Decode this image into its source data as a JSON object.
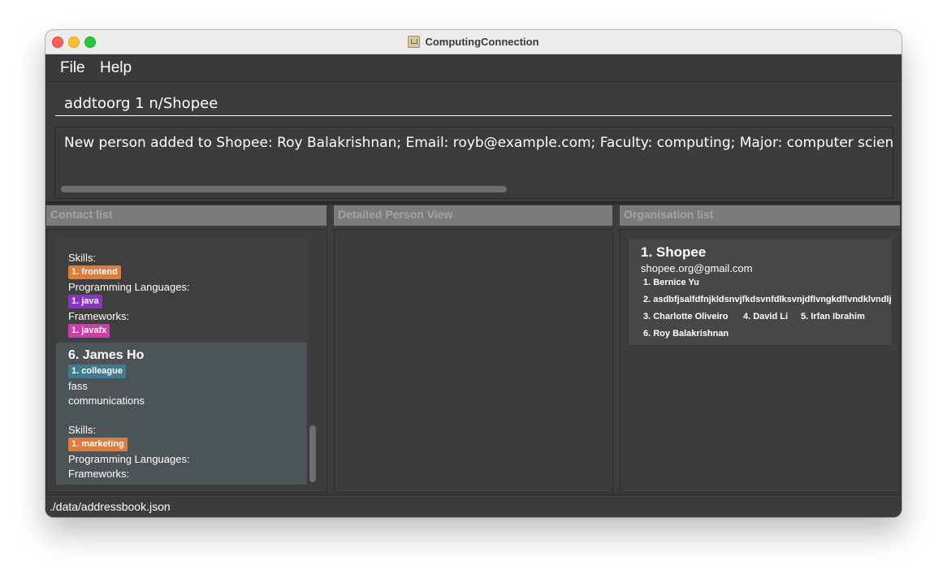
{
  "window": {
    "title": "ComputingConnection"
  },
  "menu": {
    "file": "File",
    "help": "Help"
  },
  "command": {
    "value": "addtoorg 1 n/Shopee"
  },
  "result": {
    "text": "New person added to Shopee: Roy Balakrishnan; Email: royb@example.com; Faculty: computing; Major: computer science; Compatability"
  },
  "panels": {
    "contact_list": "Contact list",
    "detail_view": "Detailed Person View",
    "org_list": "Organisation list"
  },
  "contacts": {
    "partial": {
      "skills_label": "Skills:",
      "skills": [
        "1. frontend"
      ],
      "languages_label": "Programming Languages:",
      "languages": [
        "1. java"
      ],
      "frameworks_label": "Frameworks:",
      "frameworks": [
        "1. javafx"
      ]
    },
    "james": {
      "name": "6.  James Ho",
      "tags": [
        "1. colleague"
      ],
      "faculty": "fass",
      "major": "communications",
      "skills_label": "Skills:",
      "skills": [
        "1. marketing"
      ],
      "languages_label": "Programming Languages:",
      "frameworks_label": "Frameworks:"
    }
  },
  "organisations": [
    {
      "name": "1.  Shopee",
      "email": "shopee.org@gmail.com",
      "members": [
        "1. Bernice Yu",
        "2. asdbfjsalfdfnjkldsnvjfkdsvnfdlksvnjdflvngkdflvndklvndlj",
        "3. Charlotte Oliveiro",
        "4. David Li",
        "5. Irfan Ibrahim",
        "6. Roy Balakrishnan"
      ]
    }
  ],
  "status": {
    "path": "./data/addressbook.json"
  },
  "colors": {
    "window_bg": "#3c3c3c",
    "header_bg": "#7b7b7b",
    "selected_card": "#4d5456",
    "tag_skill": "#e07b39",
    "tag_language": "#8a33c6",
    "tag_framework": "#cf3baa",
    "tag_general": "#3e7b91"
  }
}
